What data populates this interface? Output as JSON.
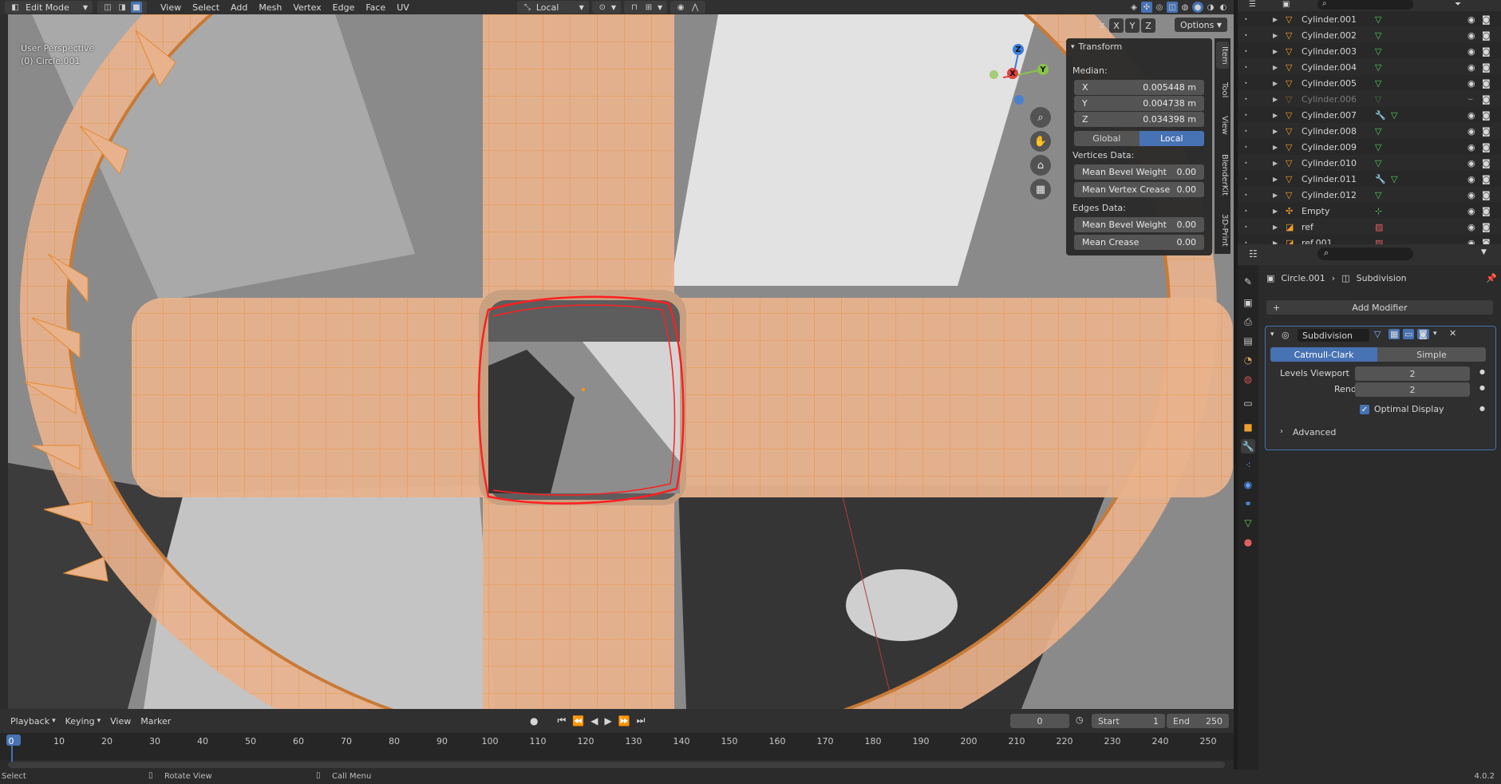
{
  "header": {
    "mode": "Edit Mode",
    "menus": [
      "View",
      "Select",
      "Add",
      "Mesh",
      "Vertex",
      "Edge",
      "Face",
      "UV"
    ],
    "orientation": "Local",
    "axes": [
      "X",
      "Y",
      "Z"
    ],
    "options_label": "Options"
  },
  "viewport": {
    "perspective_label": "User Perspective",
    "object_label": "(0) Circle.001",
    "gizmo_axes": {
      "x": "X",
      "y": "Y",
      "z": "Z"
    },
    "colors": {
      "mesh": "#e8b28d",
      "wire": "#e5892c",
      "annotation": "#ff1f1f"
    }
  },
  "npanel": {
    "title": "Transform",
    "median_label": "Median:",
    "fields": [
      {
        "axis": "X",
        "value": "0.005448 m"
      },
      {
        "axis": "Y",
        "value": "0.004738 m"
      },
      {
        "axis": "Z",
        "value": "0.034398 m"
      }
    ],
    "space_global": "Global",
    "space_local": "Local",
    "vertices_label": "Vertices Data:",
    "vertex_rows": [
      {
        "label": "Mean Bevel Weight",
        "value": "0.00"
      },
      {
        "label": "Mean Vertex Crease",
        "value": "0.00"
      }
    ],
    "edges_label": "Edges Data:",
    "edge_rows": [
      {
        "label": "Mean Bevel Weight",
        "value": "0.00"
      },
      {
        "label": "Mean Crease",
        "value": "0.00"
      }
    ],
    "tabs": [
      "Item",
      "Tool",
      "View",
      "BlenderKit",
      "3D-Print"
    ]
  },
  "outliner": {
    "items": [
      {
        "name": "Cylinder.001",
        "type": "mesh"
      },
      {
        "name": "Cylinder.002",
        "type": "mesh"
      },
      {
        "name": "Cylinder.003",
        "type": "mesh"
      },
      {
        "name": "Cylinder.004",
        "type": "mesh"
      },
      {
        "name": "Cylinder.005",
        "type": "mesh"
      },
      {
        "name": "Cylinder.006",
        "type": "mesh",
        "hidden": true
      },
      {
        "name": "Cylinder.007",
        "type": "mesh",
        "modifier": true
      },
      {
        "name": "Cylinder.008",
        "type": "mesh"
      },
      {
        "name": "Cylinder.009",
        "type": "mesh"
      },
      {
        "name": "Cylinder.010",
        "type": "mesh"
      },
      {
        "name": "Cylinder.011",
        "type": "mesh",
        "modifier": true
      },
      {
        "name": "Cylinder.012",
        "type": "mesh"
      },
      {
        "name": "Empty",
        "type": "empty"
      },
      {
        "name": "ref",
        "type": "image"
      },
      {
        "name": "ref.001",
        "type": "image"
      }
    ]
  },
  "properties": {
    "breadcrumb_object": "Circle.001",
    "breadcrumb_modifier": "Subdivision",
    "add_modifier_label": "Add Modifier",
    "modifier_name": "Subdivision",
    "algo_catmull": "Catmull-Clark",
    "algo_simple": "Simple",
    "levels_viewport_label": "Levels Viewport",
    "levels_viewport_value": "2",
    "render_label": "Render",
    "render_value": "2",
    "optimal_display_label": "Optimal Display",
    "optimal_display_checked": true,
    "advanced_label": "Advanced"
  },
  "timeline": {
    "menus": [
      "Playback",
      "Keying",
      "View",
      "Marker"
    ],
    "current_frame": "0",
    "start_label": "Start",
    "start_value": "1",
    "end_label": "End",
    "end_value": "250",
    "ruler": [
      "0",
      "10",
      "20",
      "30",
      "40",
      "50",
      "60",
      "70",
      "80",
      "90",
      "100",
      "110",
      "120",
      "130",
      "140",
      "150",
      "160",
      "170",
      "180",
      "190",
      "200",
      "210",
      "220",
      "230",
      "240",
      "250"
    ]
  },
  "statusbar": {
    "select_label": "Select",
    "rotate_label": "Rotate View",
    "call_menu_label": "Call Menu",
    "version": "4.0.2"
  }
}
